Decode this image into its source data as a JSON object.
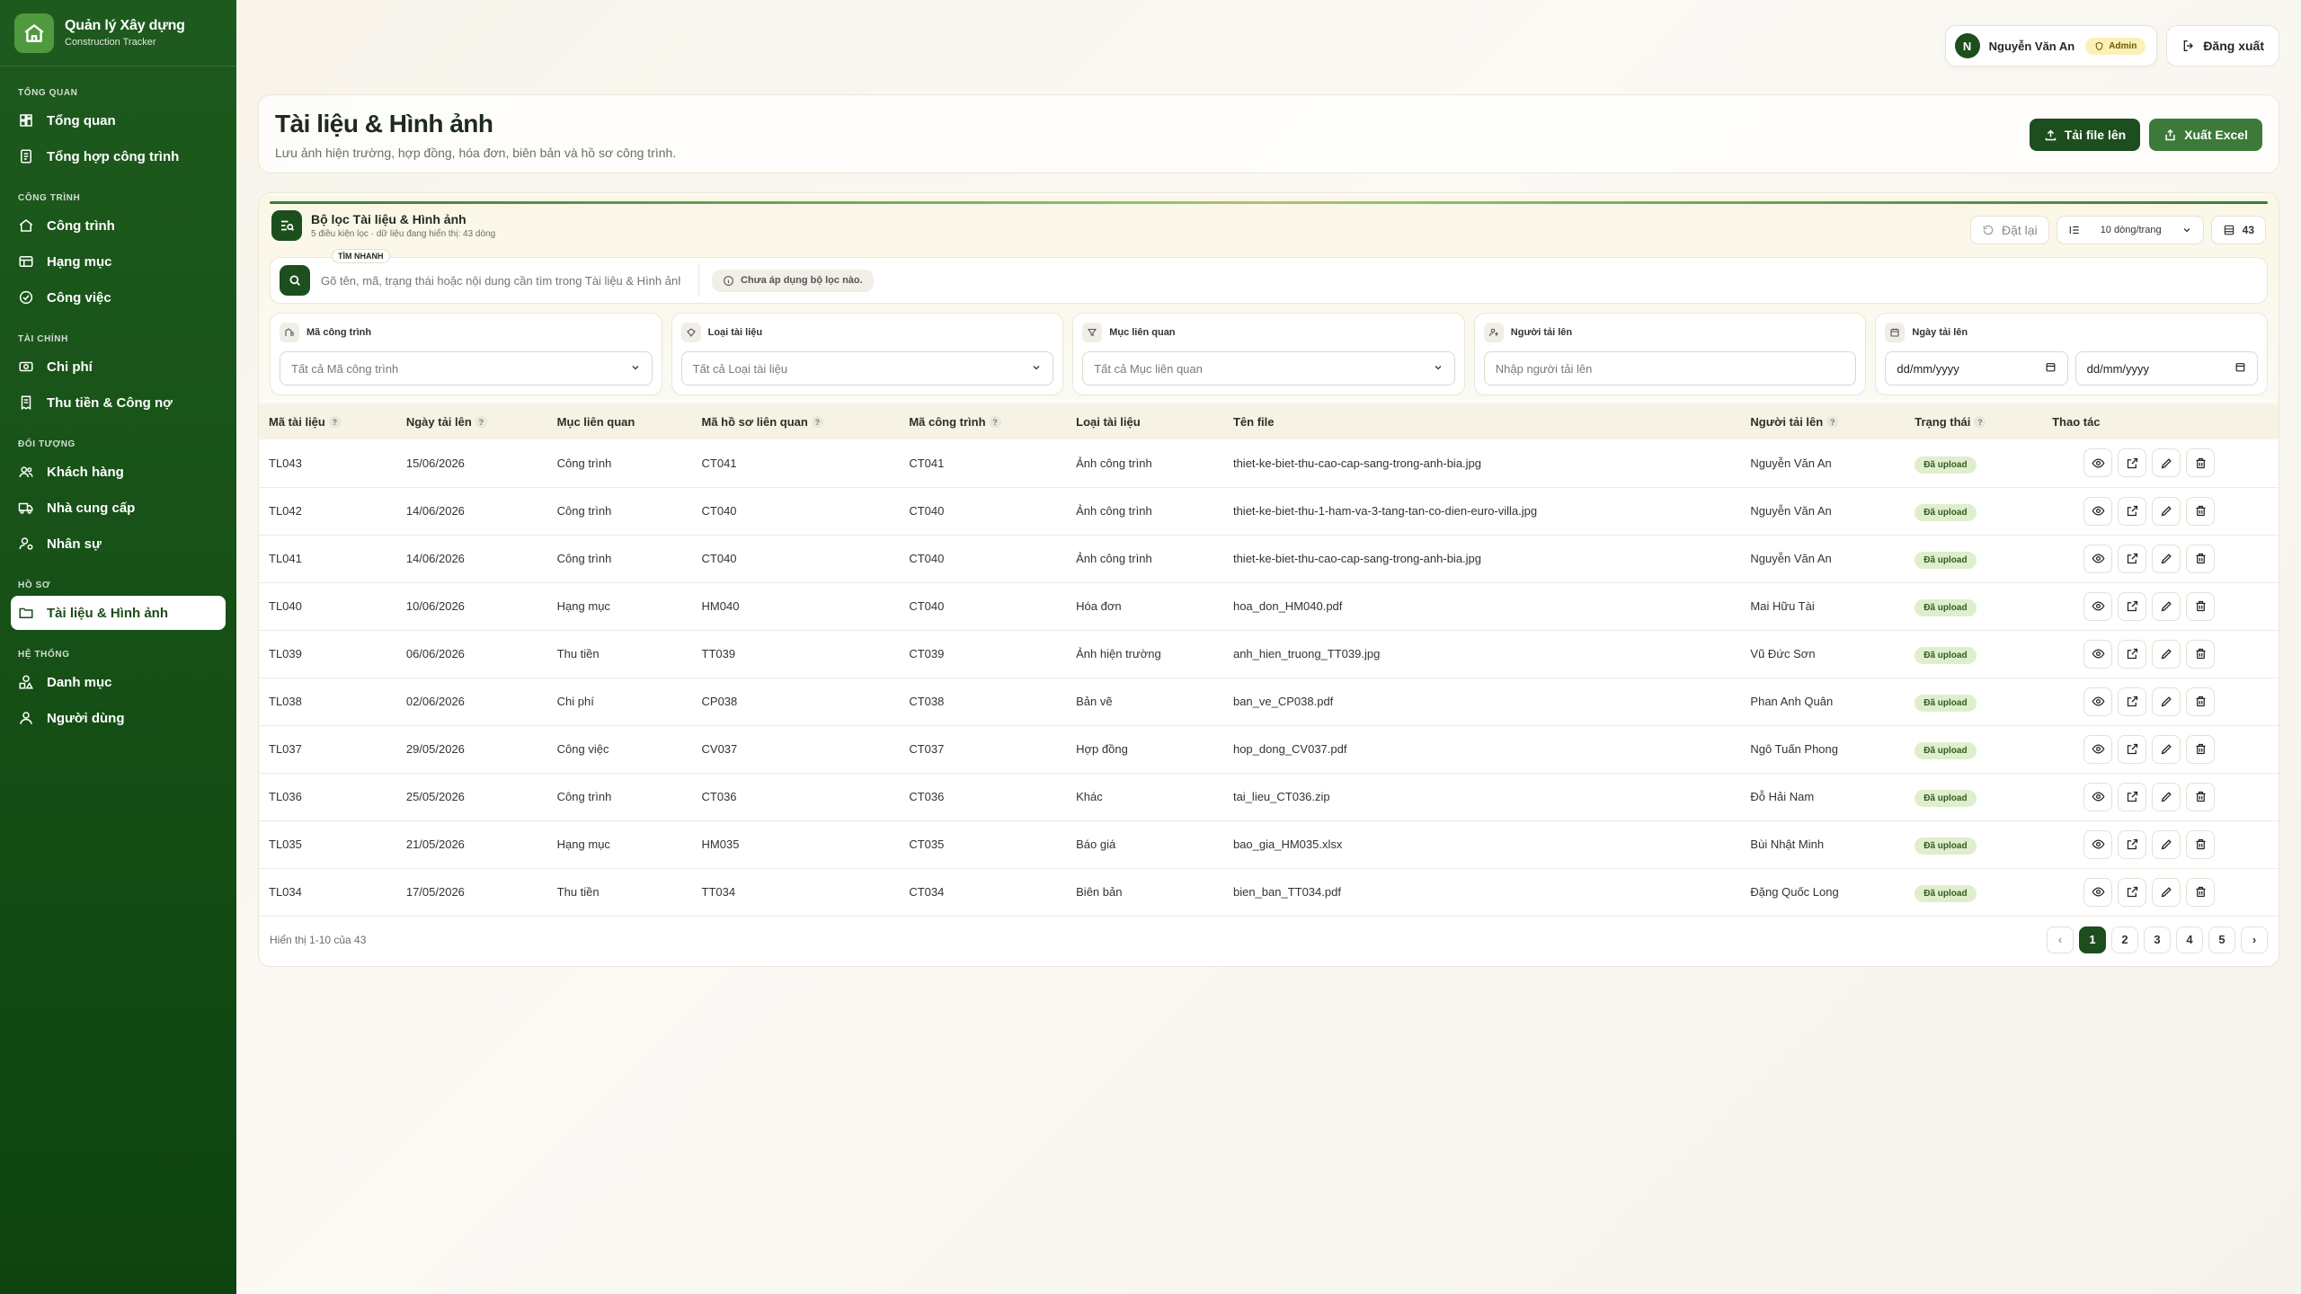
{
  "brand": {
    "title": "Quản lý Xây dựng",
    "subtitle": "Construction Tracker"
  },
  "nav": [
    {
      "section": "TỔNG QUAN",
      "items": [
        {
          "label": "Tổng quan",
          "icon": "dashboard-icon"
        },
        {
          "label": "Tổng hợp công trình",
          "icon": "building-summary-icon"
        }
      ]
    },
    {
      "section": "CÔNG TRÌNH",
      "items": [
        {
          "label": "Công trình",
          "icon": "home-icon"
        },
        {
          "label": "Hạng mục",
          "icon": "table-icon"
        },
        {
          "label": "Công việc",
          "icon": "check-circle-icon"
        }
      ]
    },
    {
      "section": "TÀI CHÍNH",
      "items": [
        {
          "label": "Chi phí",
          "icon": "money-icon"
        },
        {
          "label": "Thu tiền & Công nợ",
          "icon": "receipt-icon"
        }
      ]
    },
    {
      "section": "ĐỐI TƯỢNG",
      "items": [
        {
          "label": "Khách hàng",
          "icon": "users-icon"
        },
        {
          "label": "Nhà cung cấp",
          "icon": "truck-icon"
        },
        {
          "label": "Nhân sự",
          "icon": "user-settings-icon"
        }
      ]
    },
    {
      "section": "HỒ SƠ",
      "items": [
        {
          "label": "Tài liệu & Hình ảnh",
          "icon": "folder-icon",
          "active": true
        }
      ]
    },
    {
      "section": "HỆ THỐNG",
      "items": [
        {
          "label": "Danh mục",
          "icon": "shapes-icon"
        },
        {
          "label": "Người dùng",
          "icon": "user-icon"
        }
      ]
    }
  ],
  "user": {
    "initial": "N",
    "name": "Nguyễn Văn An",
    "role": "Admin",
    "logout": "Đăng xuất"
  },
  "header": {
    "title": "Tài liệu & Hình ảnh",
    "subtitle": "Lưu ảnh hiện trường, hợp đồng, hóa đơn, biên bản và hồ sơ công trình.",
    "upload": "Tải file lên",
    "export": "Xuất Excel"
  },
  "filter": {
    "title": "Bộ lọc Tài liệu & Hình ảnh",
    "subtitle": "5 điều kiện lọc · dữ liệu đang hiển thị: 43 dòng",
    "reset": "Đặt lại",
    "page_size": "10 dòng/trang",
    "total": "43",
    "search_tag": "TÌM NHANH",
    "search_placeholder": "Gõ tên, mã, trạng thái hoặc nội dung cần tìm trong Tài liệu & Hình ảnh...",
    "no_filter": "Chưa áp dụng bộ lọc nào.",
    "fields": [
      {
        "label": "Mã công trình",
        "value": "Tất cả Mã công trình"
      },
      {
        "label": "Loại tài liệu",
        "value": "Tất cả Loại tài liệu"
      },
      {
        "label": "Mục liên quan",
        "value": "Tất cả Mục liên quan"
      },
      {
        "label": "Người tải lên",
        "value": "Nhập người tải lên"
      }
    ],
    "date": {
      "label": "Ngày tải lên",
      "from": "dd/mm/yyyy",
      "to": "dd/mm/yyyy"
    }
  },
  "table": {
    "headers": [
      "Mã tài liệu",
      "Ngày tải lên",
      "Mục liên quan",
      "Mã hồ sơ liên quan",
      "Mã công trình",
      "Loại tài liệu",
      "Tên file",
      "Người tải lên",
      "Trạng thái",
      "Thao tác"
    ],
    "rows": [
      [
        "TL043",
        "15/06/2026",
        "Công trình",
        "CT041",
        "CT041",
        "Ảnh công trình",
        "thiet-ke-biet-thu-cao-cap-sang-trong-anh-bia.jpg",
        "Nguyễn Văn An",
        "Đã upload"
      ],
      [
        "TL042",
        "14/06/2026",
        "Công trình",
        "CT040",
        "CT040",
        "Ảnh công trình",
        "thiet-ke-biet-thu-1-ham-va-3-tang-tan-co-dien-euro-villa.jpg",
        "Nguyễn Văn An",
        "Đã upload"
      ],
      [
        "TL041",
        "14/06/2026",
        "Công trình",
        "CT040",
        "CT040",
        "Ảnh công trình",
        "thiet-ke-biet-thu-cao-cap-sang-trong-anh-bia.jpg",
        "Nguyễn Văn An",
        "Đã upload"
      ],
      [
        "TL040",
        "10/06/2026",
        "Hạng mục",
        "HM040",
        "CT040",
        "Hóa đơn",
        "hoa_don_HM040.pdf",
        "Mai Hữu Tài",
        "Đã upload"
      ],
      [
        "TL039",
        "06/06/2026",
        "Thu tiền",
        "TT039",
        "CT039",
        "Ảnh hiện trường",
        "anh_hien_truong_TT039.jpg",
        "Vũ Đức Sơn",
        "Đã upload"
      ],
      [
        "TL038",
        "02/06/2026",
        "Chi phí",
        "CP038",
        "CT038",
        "Bản vẽ",
        "ban_ve_CP038.pdf",
        "Phan Anh Quân",
        "Đã upload"
      ],
      [
        "TL037",
        "29/05/2026",
        "Công việc",
        "CV037",
        "CT037",
        "Hợp đồng",
        "hop_dong_CV037.pdf",
        "Ngô Tuấn Phong",
        "Đã upload"
      ],
      [
        "TL036",
        "25/05/2026",
        "Công trình",
        "CT036",
        "CT036",
        "Khác",
        "tai_lieu_CT036.zip",
        "Đỗ Hải Nam",
        "Đã upload"
      ],
      [
        "TL035",
        "21/05/2026",
        "Hạng mục",
        "HM035",
        "CT035",
        "Báo giá",
        "bao_gia_HM035.xlsx",
        "Bùi Nhật Minh",
        "Đã upload"
      ],
      [
        "TL034",
        "17/05/2026",
        "Thu tiền",
        "TT034",
        "CT034",
        "Biên bản",
        "bien_ban_TT034.pdf",
        "Đặng Quốc Long",
        "Đã upload"
      ]
    ],
    "help_columns": [
      0,
      1,
      3,
      4,
      7,
      8
    ]
  },
  "footer": {
    "text": "Hiển thị 1-10 của 43",
    "pages": [
      "1",
      "2",
      "3",
      "4",
      "5"
    ],
    "prev": "‹",
    "next": "›",
    "current": "1"
  },
  "colors": {
    "sidebar": "#165016",
    "accent": "#1d4e1d",
    "status_bg": "#dfeecc"
  }
}
